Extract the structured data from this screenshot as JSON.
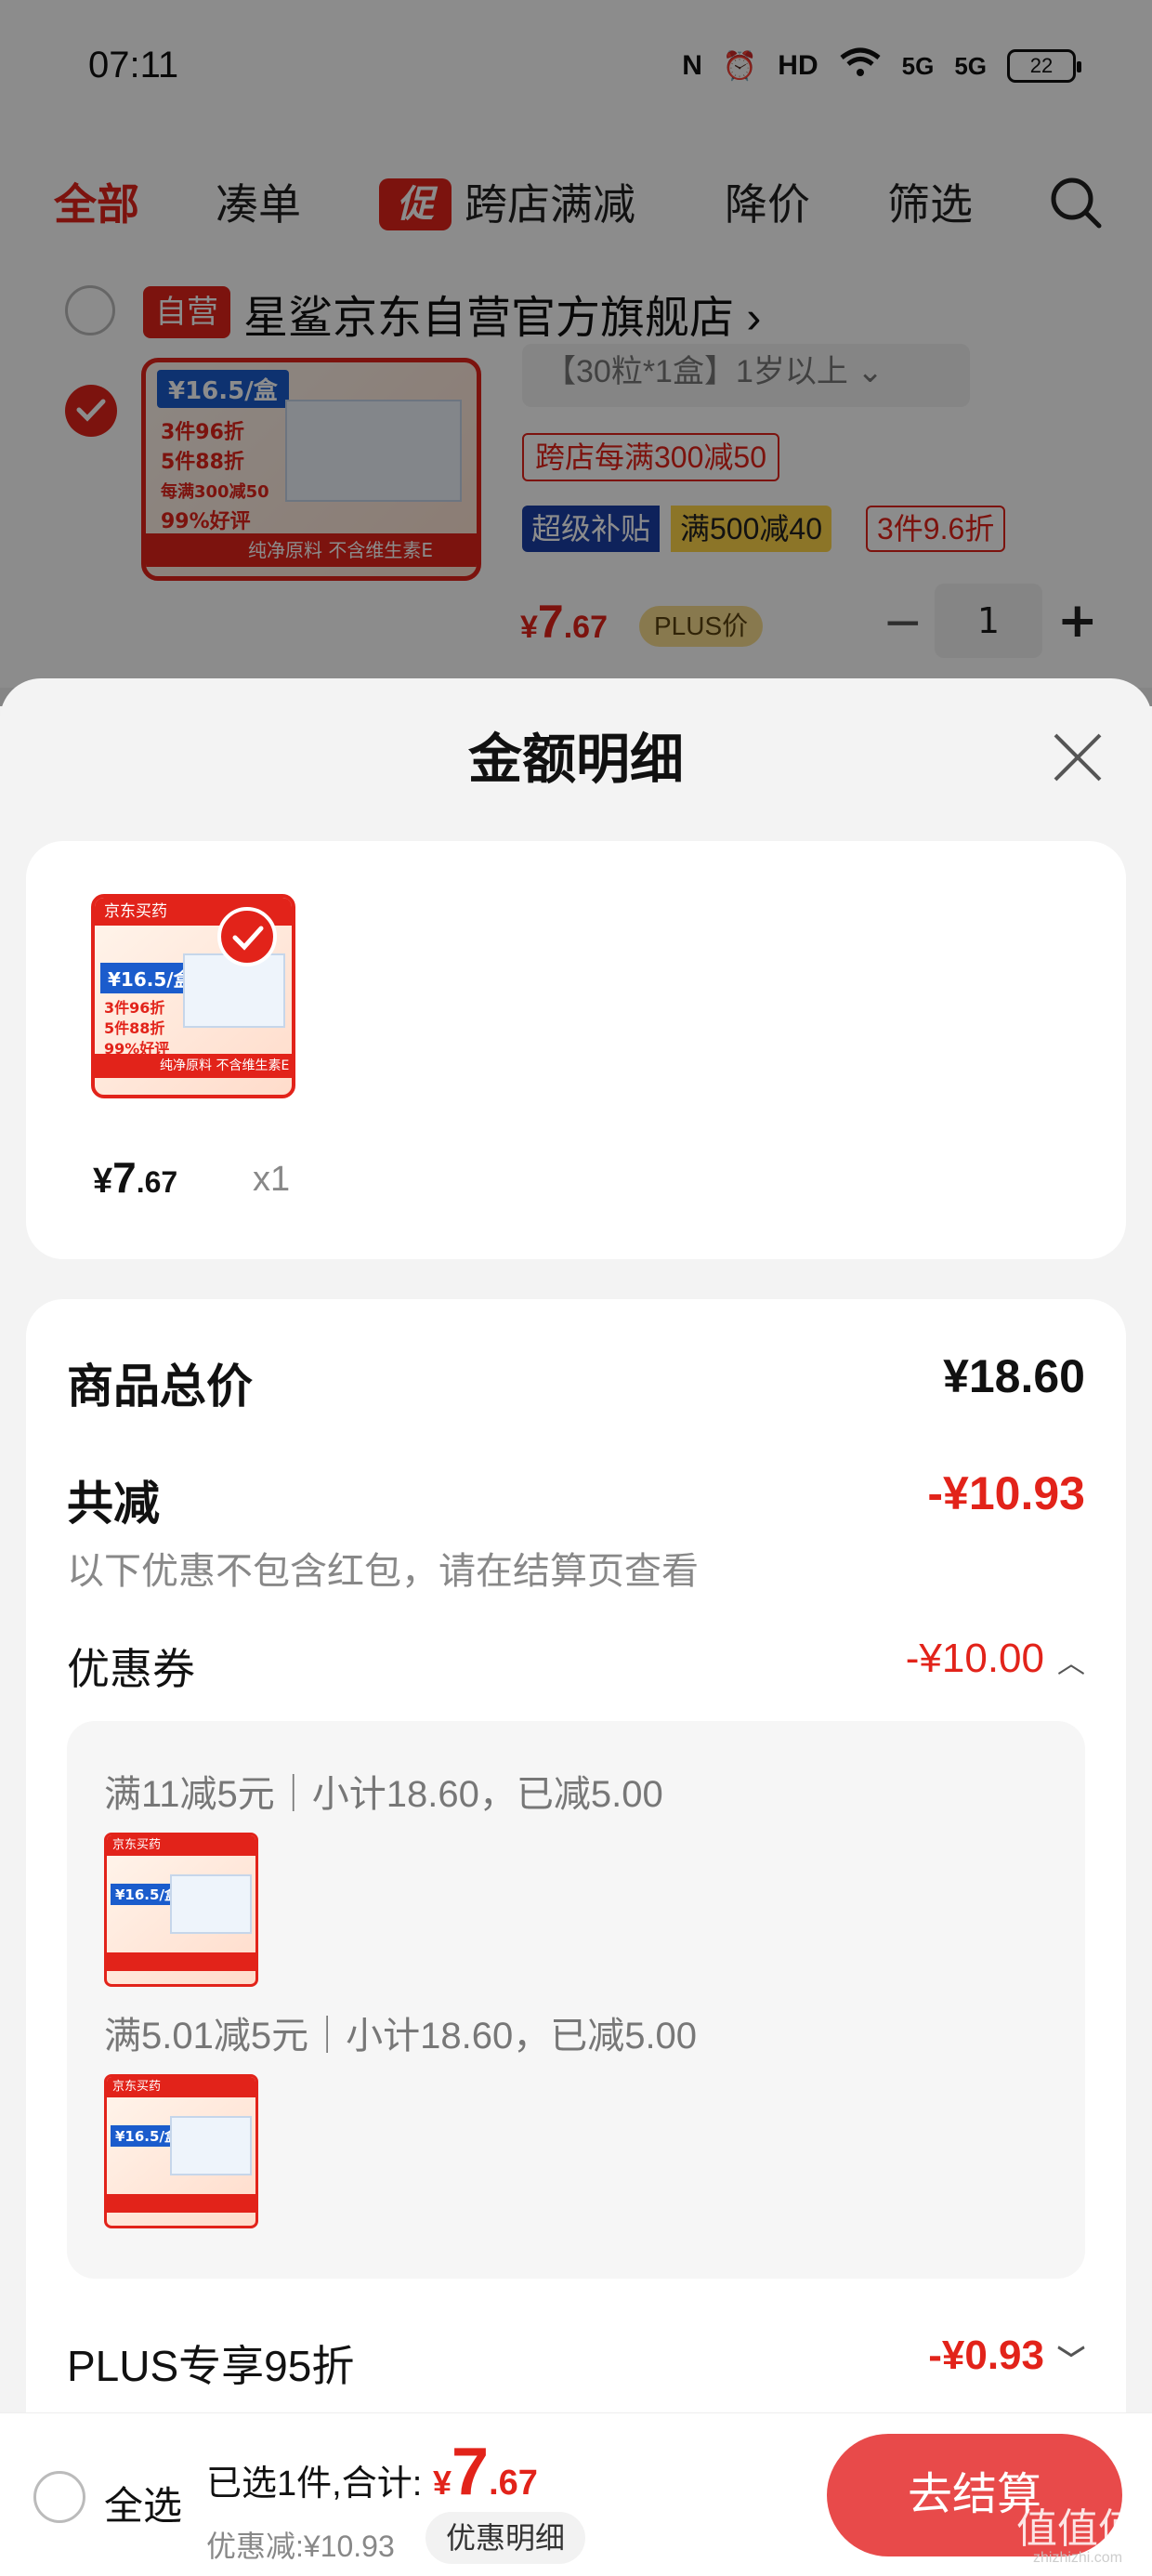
{
  "status_bar": {
    "time": "07:11",
    "nfc": "N",
    "hd": "HD",
    "sig1": "5G",
    "sig2": "5G",
    "battery": "22"
  },
  "tabs": {
    "all": "全部",
    "bundle": "凑单",
    "promo_tag": "促",
    "cross_store": "跨店满减",
    "price_drop": "降价",
    "filter": "筛选"
  },
  "shop": {
    "self_tag": "自营",
    "name": "星鲨京东自营官方旗舰店",
    "chevron": "›"
  },
  "product": {
    "img_price": "¥16.5/盒",
    "img_line1": "3件96折",
    "img_line2": "5件88折",
    "img_line3": "每满300减50",
    "img_line4": "99%好评",
    "img_strip": "纯净原料 不含维生素E",
    "spec": "【30粒*1盒】1岁以上",
    "spec_chevron": "⌄",
    "promo1": "跨店每满300减50",
    "super_tag": "超级补贴",
    "full_tag": "满500减40",
    "three_tag": "3件9.6折",
    "price_cur": "¥",
    "price_int": "7",
    "price_dec": ".67",
    "plus_tag": "PLUS价",
    "qty_minus": "−",
    "qty": "1",
    "qty_plus": "+"
  },
  "sheet": {
    "title": "金额明细",
    "item_price_cur": "¥",
    "item_price_int": "7",
    "item_price_dec": ".67",
    "item_qty": "x1",
    "thumb_head": "京东买药",
    "thumb_price": "¥16.5/盒",
    "thumb_l1": "3件96折",
    "thumb_l2": "5件88折",
    "thumb_l3": "99%好评",
    "thumb_strip": "纯净原料 不含维生素E",
    "total_label": "商品总价",
    "total_value": "¥18.60",
    "reduce_label": "共减",
    "reduce_value": "-¥10.93",
    "reduce_note": "以下优惠不包含红包，请在结算页查看",
    "coupon_label": "优惠券",
    "coupon_value": "-¥10.00",
    "coupon_chev": "︿",
    "coupon1": "满11减5元｜小计18.60，已减5.00",
    "coupon2": "满5.01减5元｜小计18.60，已减5.00",
    "mini_head": "京东买药",
    "mini_price": "¥16.5/盒",
    "plus_label": "PLUS专享95折",
    "plus_value": "-¥0.93",
    "plus_chev": "﹀"
  },
  "bottom": {
    "select_all": "全选",
    "summary": "已选1件,合计:",
    "total_cur": "¥",
    "total_int": "7",
    "total_dec": ".67",
    "discount": "优惠减:¥10.93",
    "detail_btn": "优惠明细",
    "checkout": "去结算",
    "watermark": "值值值",
    "watermark_url": "zhizhizhi.com"
  },
  "colors": {
    "accent": "#e2231a",
    "checkout": "#e84a4a",
    "plus_gold": "#f7dc8e",
    "super_blue": "#1b3fa6",
    "full_yellow": "#ffd54a"
  }
}
